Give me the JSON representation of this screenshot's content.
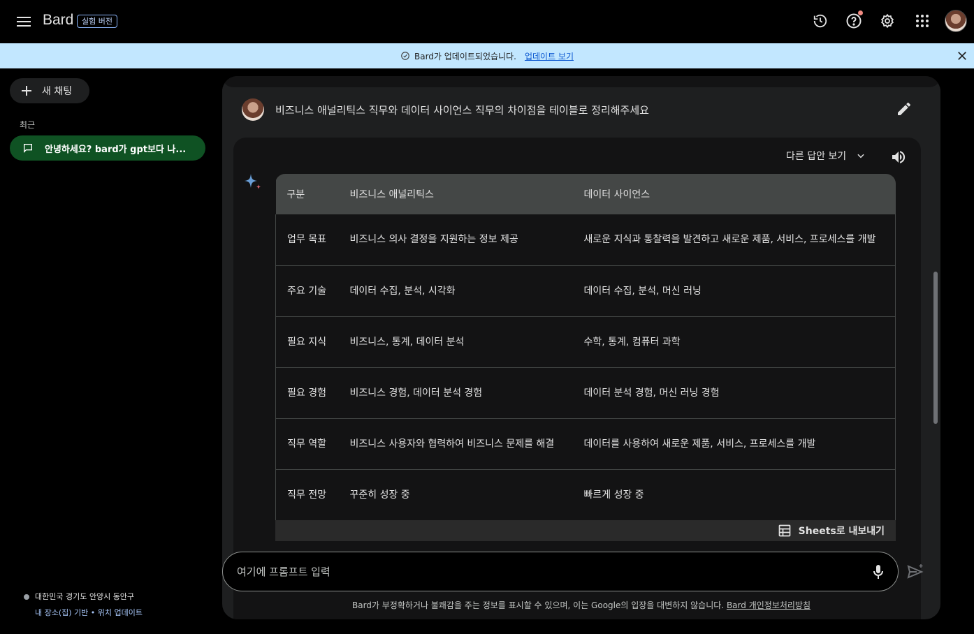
{
  "app": {
    "brand": "Bard",
    "badge": "실험 버전"
  },
  "banner": {
    "message": "Bard가 업데이트되었습니다.",
    "link": "업데이트 보기"
  },
  "sidebar": {
    "new_chat": "새 채팅",
    "recent_label": "최근",
    "recent_items": [
      {
        "label": "안녕하세요? bard가 gpt보다 나..."
      }
    ],
    "location": {
      "place": "대한민국 경기도 안양시 동안구",
      "sub": "내 장소(집) 기반 • 위치 업데이트"
    }
  },
  "conversation": {
    "prompt": "비즈니스 애널리틱스 직무와 데이터 사이언스 직무의 차이점을 테이블로 정리해주세요",
    "drafts_label": "다른 답안 보기",
    "table": {
      "headers": [
        "구분",
        "비즈니스 애널리틱스",
        "데이터 사이언스"
      ],
      "rows": [
        [
          "업무 목표",
          "비즈니스 의사 결정을 지원하는 정보 제공",
          "새로운 지식과 통찰력을 발견하고 새로운 제품, 서비스, 프로세스를 개발"
        ],
        [
          "주요 기술",
          "데이터 수집, 분석, 시각화",
          "데이터 수집, 분석, 머신 러닝"
        ],
        [
          "필요 지식",
          "비즈니스, 통계, 데이터 분석",
          "수학, 통계, 컴퓨터 과학"
        ],
        [
          "필요 경험",
          "비즈니스 경험, 데이터 분석 경험",
          "데이터 분석 경험, 머신 러닝 경험"
        ],
        [
          "직무 역할",
          "비즈니스 사용자와 협력하여 비즈니스 문제를 해결",
          "데이터를 사용하여 새로운 제품, 서비스, 프로세스를 개발"
        ],
        [
          "직무 전망",
          "꾸준히 성장 중",
          "빠르게 성장 중"
        ]
      ]
    },
    "export_label": "Sheets로 내보내기"
  },
  "input": {
    "placeholder": "여기에 프롬프트 입력"
  },
  "footer": {
    "disclaimer": "Bard가 부정확하거나 불쾌감을 주는 정보를 표시할 수 있으며, 이는 Google의 입장을 대변하지 않습니다.",
    "privacy_link": "Bard 개인정보처리방침"
  },
  "colors": {
    "banner_bg": "#c2e7ff",
    "recent_active_bg": "#0f5223",
    "table_header_bg": "#444746",
    "notification_dot": "#f28b82"
  },
  "icons": [
    "menu-icon",
    "history-icon",
    "help-icon",
    "settings-icon",
    "apps-icon",
    "check-circle-icon",
    "close-icon",
    "plus-icon",
    "chat-icon",
    "edit-icon",
    "chevron-down-icon",
    "speaker-icon",
    "sparkle-icon",
    "sheets-icon",
    "mic-icon",
    "send-icon"
  ]
}
